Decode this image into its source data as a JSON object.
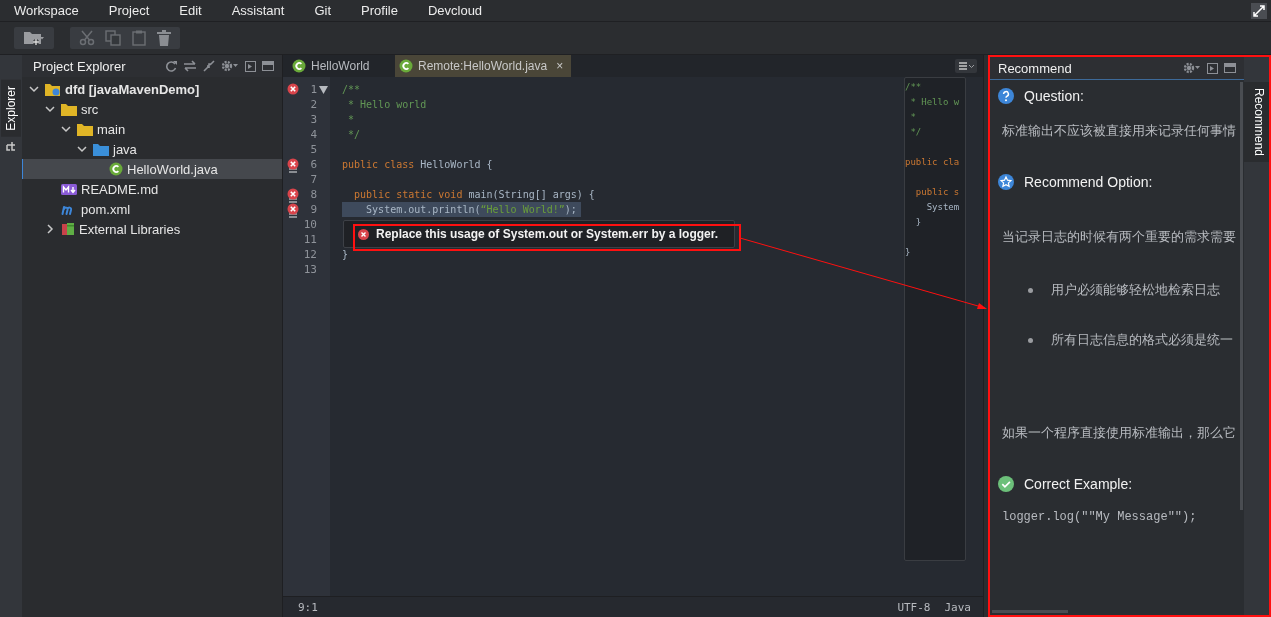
{
  "menu": [
    {
      "label": "Workspace"
    },
    {
      "label": "Project"
    },
    {
      "label": "Edit"
    },
    {
      "label": "Assistant"
    },
    {
      "label": "Git"
    },
    {
      "label": "Profile"
    },
    {
      "label": "Devcloud"
    }
  ],
  "left_side_tab": {
    "label": "Explorer",
    "selected": true
  },
  "explorer": {
    "title": "Project Explorer",
    "tree": [
      {
        "label": "dfd [javaMavenDemo]",
        "kind": "project",
        "expanded": true,
        "selected": false,
        "children": [
          {
            "label": "src",
            "kind": "folder",
            "expanded": true,
            "selected": false,
            "children": [
              {
                "label": "main",
                "kind": "folder",
                "expanded": true,
                "selected": false,
                "children": [
                  {
                    "label": "java",
                    "kind": "source-folder",
                    "expanded": true,
                    "selected": false,
                    "children": [
                      {
                        "label": "HelloWorld.java",
                        "kind": "class",
                        "selected": true
                      }
                    ]
                  }
                ]
              }
            ]
          },
          {
            "label": "README.md",
            "kind": "markdown",
            "selected": false
          },
          {
            "label": "pom.xml",
            "kind": "maven",
            "selected": false
          },
          {
            "label": "External Libraries",
            "kind": "library",
            "expanded": false,
            "selected": false
          }
        ]
      }
    ]
  },
  "editor": {
    "tabs": [
      {
        "label": "HelloWorld",
        "selected": false
      },
      {
        "label": "Remote:HelloWorld.java",
        "selected": true,
        "close": "×"
      }
    ],
    "lines": [
      {
        "number": "1",
        "kind": "error",
        "fold": true,
        "highlighted": false,
        "tokens": [
          {
            "kind": "comment",
            "text": "/**"
          }
        ]
      },
      {
        "number": "2",
        "highlighted": false,
        "tokens": [
          {
            "kind": "comment",
            "text": " * Hello world"
          }
        ]
      },
      {
        "number": "3",
        "highlighted": false,
        "tokens": [
          {
            "kind": "comment",
            "text": " *"
          }
        ]
      },
      {
        "number": "4",
        "highlighted": false,
        "tokens": [
          {
            "kind": "comment",
            "text": " */"
          }
        ]
      },
      {
        "number": "5",
        "highlighted": false
      },
      {
        "number": "6",
        "kind": "multi-error",
        "highlighted": false,
        "tokens": [
          {
            "kind": "keyword",
            "text": "public class"
          },
          {
            "kind": "plain",
            "text": " HelloWorld {"
          }
        ]
      },
      {
        "number": "7",
        "highlighted": false
      },
      {
        "number": "8",
        "kind": "multi-error",
        "highlighted": false,
        "tokens": [
          {
            "kind": "keyword",
            "text": "  public static void"
          },
          {
            "kind": "plain",
            "text": " main(String[] args) {"
          }
        ]
      },
      {
        "number": "9",
        "kind": "multi-error",
        "highlighted": true,
        "tokens": [
          {
            "kind": "plain",
            "text": "    System.out.println("
          },
          {
            "kind": "string",
            "text": "“Hello World!”"
          },
          {
            "kind": "plain",
            "text": ");"
          }
        ]
      },
      {
        "number": "10",
        "highlighted": false
      },
      {
        "number": "11",
        "highlighted": false
      },
      {
        "number": "12",
        "highlighted": false,
        "tokens": [
          {
            "kind": "plain",
            "text": "}"
          }
        ]
      },
      {
        "number": "13",
        "highlighted": false
      }
    ],
    "tooltip": {
      "text": "Replace this usage of System.out or System.err by a logger."
    },
    "minimap": [
      {
        "kind": "comment",
        "text": "/**"
      },
      {
        "kind": "comment",
        "text": " * Hello w"
      },
      {
        "kind": "comment",
        "text": " *"
      },
      {
        "kind": "comment",
        "text": " */"
      },
      {
        "kind": "blank"
      },
      {
        "kind": "keyword",
        "text": "public cla"
      },
      {
        "kind": "blank"
      },
      {
        "kind": "keyword",
        "text": "  public s"
      },
      {
        "kind": "plain",
        "text": "    System"
      },
      {
        "kind": "plain",
        "text": "  }"
      },
      {
        "kind": "blank"
      },
      {
        "kind": "plain",
        "text": "}"
      }
    ],
    "status": {
      "position": "9:1",
      "encoding": "UTF-8",
      "language": "Java"
    }
  },
  "recommend": {
    "title": "Recommend",
    "blocks": [
      {
        "kind": "question",
        "text": "Question:"
      },
      {
        "kind": "paragraph",
        "text": "标准输出不应该被直接用来记录任何事情"
      },
      {
        "kind": "option",
        "text": "Recommend Option:"
      },
      {
        "kind": "paragraph",
        "text": "当记录日志的时候有两个重要的需求需要"
      },
      {
        "kind": "bullet",
        "text": "用户必须能够轻松地检索日志"
      },
      {
        "kind": "bullet",
        "text": "所有日志信息的格式必须是统一"
      },
      {
        "kind": "paragraph",
        "text": "如果一个程序直接使用标准输出，那么它"
      },
      {
        "kind": "example",
        "text": "Correct Example:"
      },
      {
        "kind": "code",
        "text": "logger.log(\"\"My Message\"\");"
      }
    ]
  },
  "right_side_tab": {
    "label": "Recommend",
    "selected": true
  }
}
